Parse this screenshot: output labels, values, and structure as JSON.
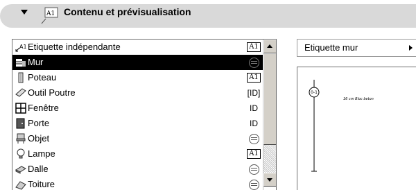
{
  "header": {
    "title": "Contenu et prévisualisation",
    "icon_text": "A1"
  },
  "list": {
    "items": [
      {
        "label": "Etiquette indépendante",
        "icon": "label-arrow-icon",
        "icon_text": "A1",
        "badge": "box",
        "badge_text": "A1"
      },
      {
        "label": "Mur",
        "icon": "wall-icon",
        "badge": "circle",
        "badge_text": "",
        "selected": true
      },
      {
        "label": "Poteau",
        "icon": "column-icon",
        "badge": "box",
        "badge_text": "A1"
      },
      {
        "label": "Outil Poutre",
        "icon": "beam-icon",
        "badge": "id-bracket",
        "badge_text": "[ID]"
      },
      {
        "label": "Fenêtre",
        "icon": "window-icon",
        "badge": "id",
        "badge_text": "ID"
      },
      {
        "label": "Porte",
        "icon": "door-icon",
        "badge": "id",
        "badge_text": "ID"
      },
      {
        "label": "Objet",
        "icon": "object-icon",
        "badge": "circle",
        "badge_text": ""
      },
      {
        "label": "Lampe",
        "icon": "lamp-icon",
        "badge": "box",
        "badge_text": "A1"
      },
      {
        "label": "Dalle",
        "icon": "slab-icon",
        "badge": "circle",
        "badge_text": ""
      },
      {
        "label": "Toiture",
        "icon": "roof-icon",
        "badge": "circle",
        "badge_text": ""
      }
    ]
  },
  "dropdown": {
    "value": "Etiquette mur"
  },
  "preview": {
    "marker_text": "0-1",
    "note": "16 cm  Bloc beton"
  }
}
